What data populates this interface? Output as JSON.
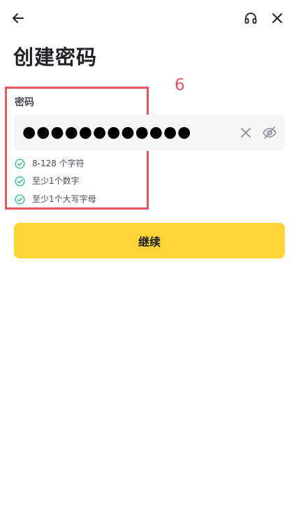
{
  "header": {
    "back_icon": "arrow-left-icon",
    "support_icon": "headset-icon",
    "close_icon": "close-icon"
  },
  "page": {
    "title": "创建密码"
  },
  "annotation": {
    "label": "6",
    "color": "#e8545c"
  },
  "password": {
    "label": "密码",
    "masked_value": "●●●●●●●●●●●●",
    "clear_icon": "clear-icon",
    "visibility_icon": "eye-off-icon"
  },
  "rules": [
    {
      "text": "8-128 个字符",
      "satisfied": true
    },
    {
      "text": "至少1个数字",
      "satisfied": true
    },
    {
      "text": "至少1个大写字母",
      "satisfied": true
    }
  ],
  "actions": {
    "continue_label": "继续"
  },
  "colors": {
    "accent": "#fcd535",
    "check": "#2ebd85",
    "text": "#1e2026",
    "muted": "#474d57",
    "field_bg": "#f5f5f5",
    "annotation": "#e8545c"
  }
}
